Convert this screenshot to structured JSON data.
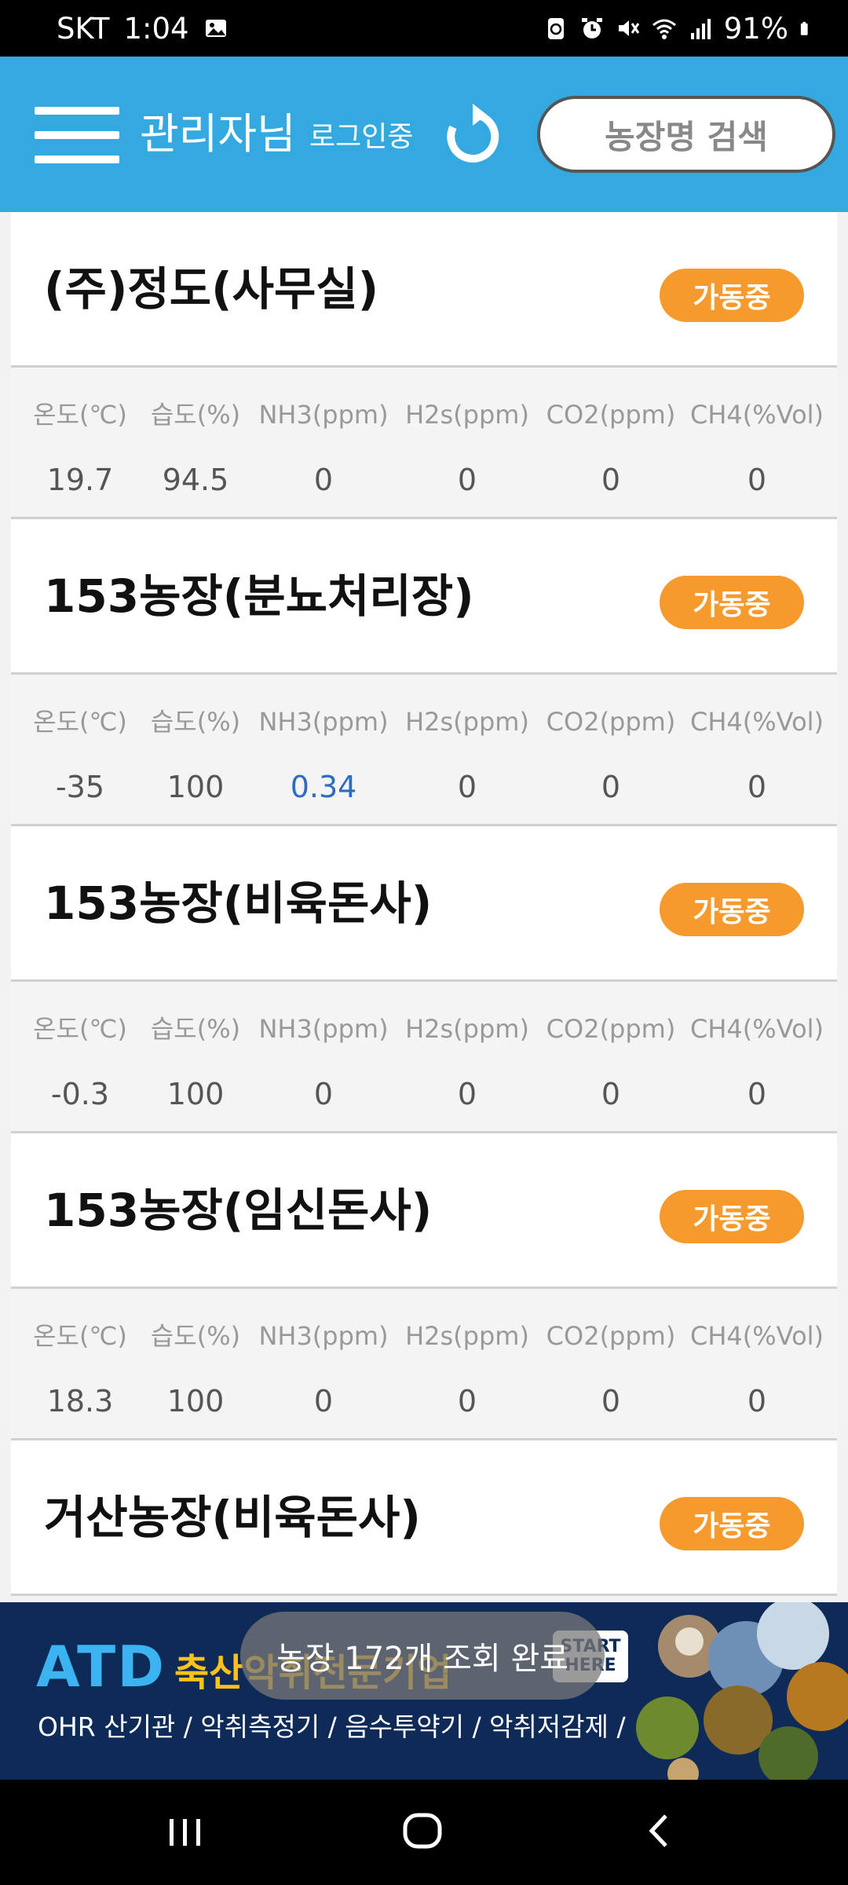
{
  "status_bar": {
    "carrier": "SKT",
    "time": "1:04",
    "battery": "91%",
    "icons": [
      "image-icon",
      "recycle-icon",
      "alarm-icon",
      "mute-icon",
      "wifi-icon",
      "signal-icon",
      "battery-icon"
    ]
  },
  "header": {
    "admin_name": "관리자님",
    "login_status": "로그인중",
    "search_label": "농장명 검색",
    "bg_color": "#33a9e0"
  },
  "columns": [
    "온도(℃)",
    "습도(%)",
    "NH3(ppm)",
    "H2s(ppm)",
    "CO2(ppm)",
    "CH4(%Vol)"
  ],
  "farms": [
    {
      "name": "(주)정도(사무실)",
      "status": "가동중",
      "values": [
        "19.7",
        "94.5",
        "0",
        "0",
        "0",
        "0"
      ]
    },
    {
      "name": "153농장(분뇨처리장)",
      "status": "가동중",
      "values": [
        "-35",
        "100",
        "0.34",
        "0",
        "0",
        "0"
      ]
    },
    {
      "name": "153농장(비육돈사)",
      "status": "가동중",
      "values": [
        "-0.3",
        "100",
        "0",
        "0",
        "0",
        "0"
      ]
    },
    {
      "name": "153농장(임신돈사)",
      "status": "가동중",
      "values": [
        "18.3",
        "100",
        "0",
        "0",
        "0",
        "0"
      ]
    },
    {
      "name": "거산농장(비육돈사)",
      "status": "가동중",
      "values": []
    }
  ],
  "banner": {
    "logo": "ATD",
    "title": "축산악취전문기업",
    "subtitle": "OHR 산기관 / 악취측정기 / 음수투약기 / 악취저감제 / 분뇨발효제",
    "start_line1": "START",
    "start_line2": "HERE"
  },
  "toast": "농장 172개 조회 완료",
  "colors": {
    "badge": "#f79a2e",
    "highlight_value": "#2d6cc0"
  }
}
